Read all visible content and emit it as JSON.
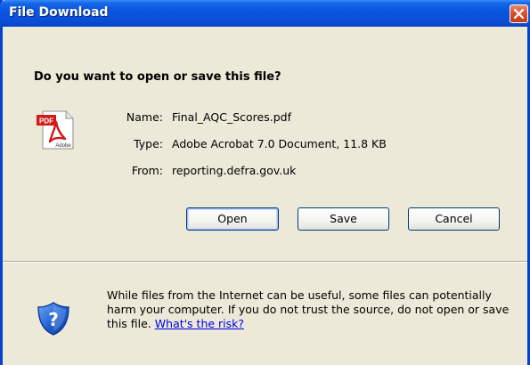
{
  "window": {
    "title": "File Download",
    "close_icon": "close-icon"
  },
  "dialog": {
    "question": "Do you want to open or save this file?",
    "file_icon": "pdf-document-icon",
    "name_label": "Name:",
    "name_value": "Final_AQC_Scores.pdf",
    "type_label": "Type:",
    "type_value": "Adobe Acrobat 7.0 Document, 11.8 KB",
    "from_label": "From:",
    "from_value": "reporting.defra.gov.uk"
  },
  "buttons": {
    "open_label": "Open",
    "save_label": "Save",
    "cancel_label": "Cancel"
  },
  "warning": {
    "icon": "security-shield-question-icon",
    "text": "While files from the Internet can be useful, some files can potentially harm your computer. If you do not trust the source, do not open or save this file.",
    "link_text": "What's the risk?"
  },
  "colors": {
    "titlebar": "#0a55e0",
    "dialog_background": "#ece9d8",
    "close_button": "#d9532d",
    "link": "#0000ee"
  }
}
